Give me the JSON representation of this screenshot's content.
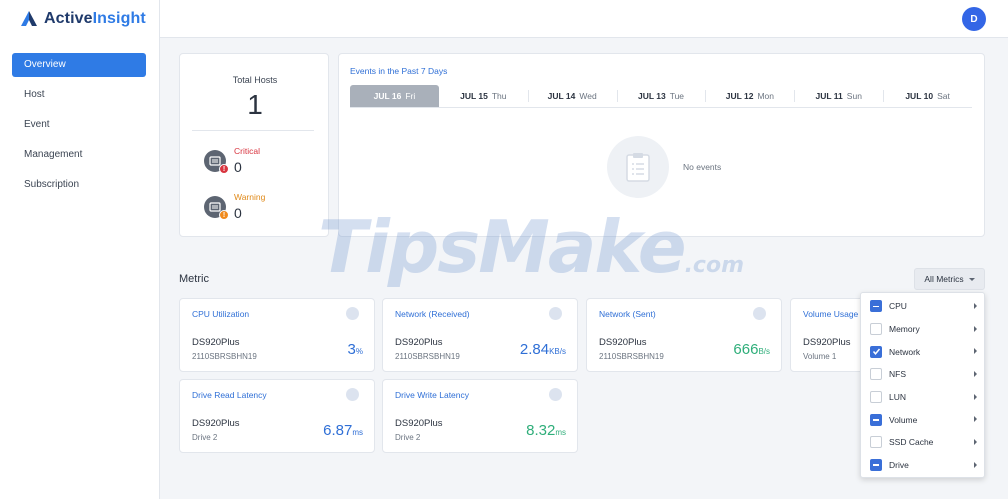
{
  "app": {
    "name_part1": "Active",
    "name_part2": "Insight",
    "user_initial": "D",
    "accent": "#2f7be5"
  },
  "sidebar": {
    "items": [
      {
        "label": "Overview",
        "active": true
      },
      {
        "label": "Host"
      },
      {
        "label": "Event"
      },
      {
        "label": "Management"
      },
      {
        "label": "Subscription"
      }
    ]
  },
  "summary": {
    "total_hosts_label": "Total Hosts",
    "total_hosts_value": "1",
    "critical_label": "Critical",
    "critical_value": "0",
    "warning_label": "Warning",
    "warning_value": "0"
  },
  "events": {
    "title": "Events in the Past 7 Days",
    "days": [
      {
        "date": "JUL 16",
        "weekday": "Fri",
        "active": true
      },
      {
        "date": "JUL 15",
        "weekday": "Thu"
      },
      {
        "date": "JUL 14",
        "weekday": "Wed"
      },
      {
        "date": "JUL 13",
        "weekday": "Tue"
      },
      {
        "date": "JUL 12",
        "weekday": "Mon"
      },
      {
        "date": "JUL 11",
        "weekday": "Sun"
      },
      {
        "date": "JUL 10",
        "weekday": "Sat"
      }
    ],
    "empty_text": "No events"
  },
  "metric": {
    "title": "Metric",
    "filter_label": "All Metrics",
    "cards": [
      {
        "title": "CPU Utilization",
        "device": "DS920Plus",
        "sub": "2110SBRSBHN19",
        "value": "3",
        "unit": "%",
        "color": "blue"
      },
      {
        "title": "Network (Received)",
        "device": "DS920Plus",
        "sub": "2110SBRSBHN19",
        "value": "2.84",
        "unit": "KB/s",
        "color": "blue"
      },
      {
        "title": "Network (Sent)",
        "device": "DS920Plus",
        "sub": "2110SBRSBHN19",
        "value": "666",
        "unit": "B/s",
        "color": "green"
      },
      {
        "title": "Volume Usage T",
        "device": "DS920Plus",
        "sub": "Volume 1",
        "value": "",
        "unit": "",
        "color": "blue"
      },
      {
        "title": "Drive Read Latency",
        "device": "DS920Plus",
        "sub": "Drive 2",
        "value": "6.87",
        "unit": "ms",
        "color": "blue"
      },
      {
        "title": "Drive Write Latency",
        "device": "DS920Plus",
        "sub": "Drive 2",
        "value": "8.32",
        "unit": "ms",
        "color": "green"
      }
    ]
  },
  "dropdown": {
    "items": [
      {
        "label": "CPU",
        "state": "partial"
      },
      {
        "label": "Memory",
        "state": "unchecked"
      },
      {
        "label": "Network",
        "state": "checked"
      },
      {
        "label": "NFS",
        "state": "unchecked"
      },
      {
        "label": "LUN",
        "state": "unchecked"
      },
      {
        "label": "Volume",
        "state": "partial"
      },
      {
        "label": "SSD Cache",
        "state": "unchecked"
      },
      {
        "label": "Drive",
        "state": "partial"
      }
    ]
  },
  "watermark": {
    "main": "TipsMake",
    "suffix": ".com"
  }
}
